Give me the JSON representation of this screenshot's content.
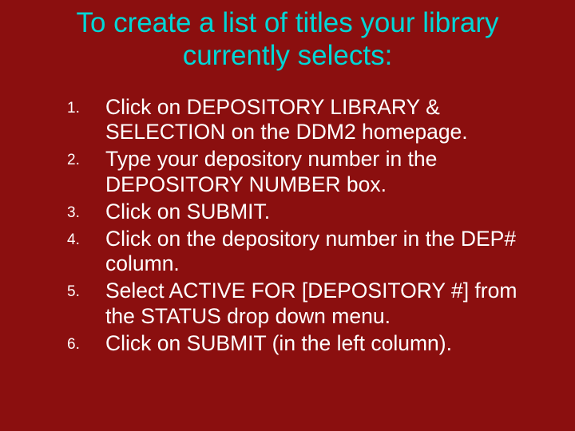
{
  "title": "To create a list of titles your library currently selects:",
  "steps": [
    "Click on DEPOSITORY LIBRARY & SELECTION on the DDM2 homepage.",
    "Type your depository number in the DEPOSITORY NUMBER box.",
    "Click on SUBMIT.",
    "Click on the depository number in the DEP# column.",
    "Select ACTIVE FOR [DEPOSITORY #] from the STATUS drop down menu.",
    "Click on SUBMIT (in the left column)."
  ]
}
